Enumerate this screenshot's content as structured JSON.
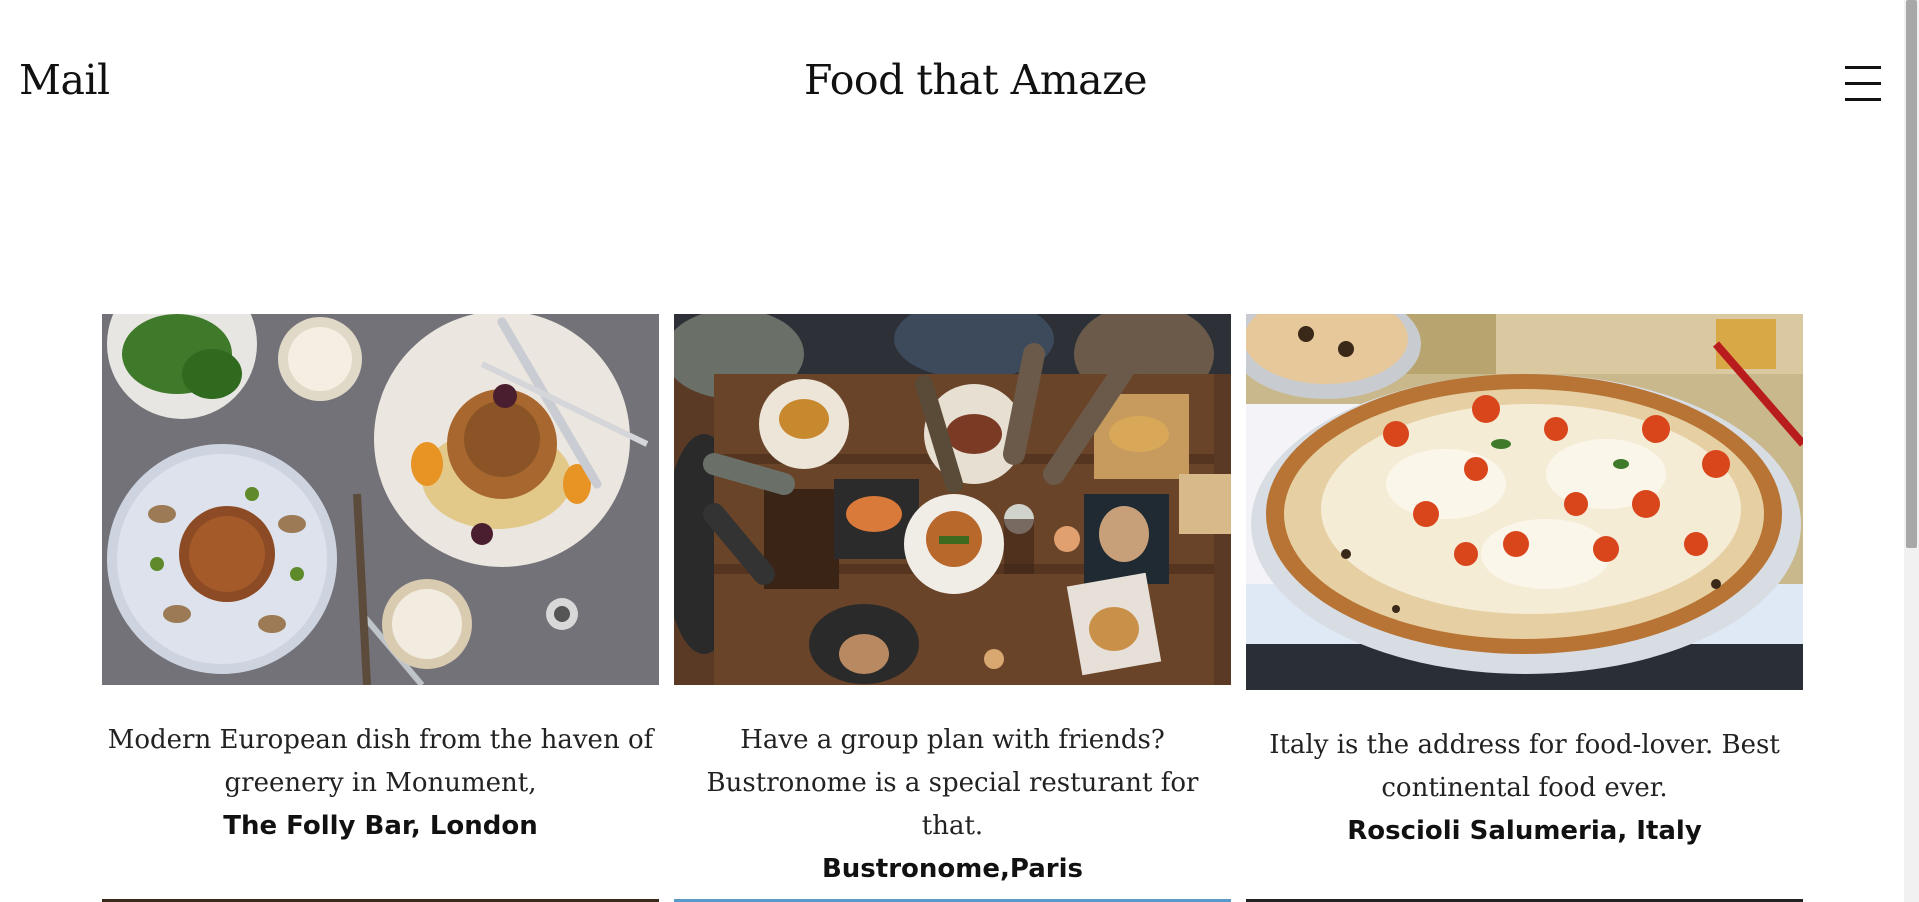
{
  "header": {
    "brand": "Mail",
    "title": "Food that Amaze",
    "menu_icon": "hamburger-menu-icon"
  },
  "cards": [
    {
      "image_alt": "Plated dishes with mushrooms, greens and beer on a grey table",
      "description": "Modern European dish from the haven of greenery in Monument,",
      "place": "The Folly Bar, London"
    },
    {
      "image_alt": "Friends sharing plates of food around a wooden table",
      "description": "Have a group plan with friends? Bustronome is a special resturant for that.",
      "place": "Bustronome,Paris"
    },
    {
      "image_alt": "Margherita pizza with cherry tomatoes on a plate",
      "description": "Italy is the address for food-lover. Best continental food ever.",
      "place": "Roscioli Salumeria, Italy"
    }
  ],
  "colors": {
    "background": "#ffffff",
    "text": "#111111",
    "scrollbar_thumb": "#a8a8a8"
  }
}
